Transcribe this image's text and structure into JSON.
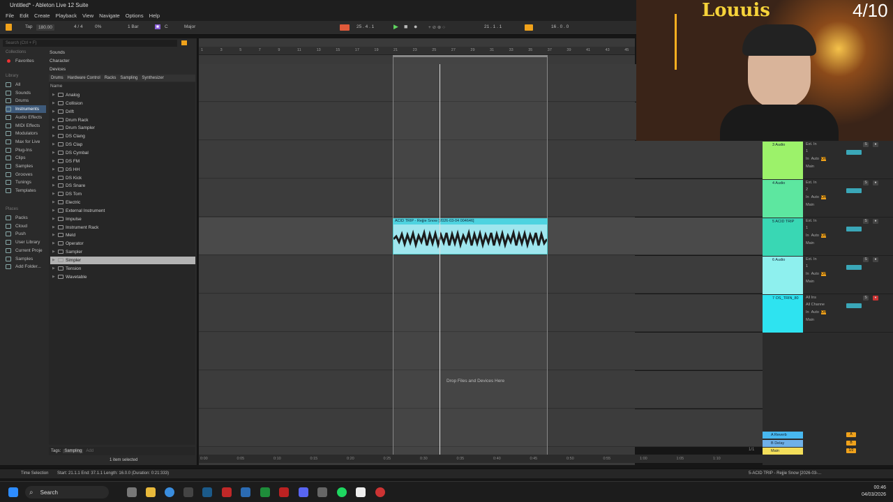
{
  "window": {
    "title": "Untitled* - Ableton Live 12 Suite"
  },
  "menu": [
    "File",
    "Edit",
    "Create",
    "Playback",
    "View",
    "Navigate",
    "Options",
    "Help"
  ],
  "transport": {
    "tap": "Tap",
    "tempo": "180.00",
    "signature": "4 / 4",
    "percent": "0%",
    "quant": "1 Bar",
    "key": "C",
    "scale": "Major",
    "position": "25 . 4 . 1",
    "loop_start": "21 . 1 . 1",
    "loop_length": "16 . 0 . 0"
  },
  "browser": {
    "search_placeholder": "Search (Ctrl + F)",
    "collections_head": "Collections",
    "favorites": "Favorites",
    "library_head": "Library",
    "library_items": [
      "All",
      "Sounds",
      "Drums",
      "Instruments",
      "Audio Effects",
      "MIDI Effects",
      "Modulators",
      "Max for Live",
      "Plug-Ins",
      "Clips",
      "Samples",
      "Grooves",
      "Tunings",
      "Templates"
    ],
    "places_head": "Places",
    "places_items": [
      "Packs",
      "Cloud",
      "Push",
      "User Library",
      "Current Proje",
      "Samples",
      "Add Folder..."
    ],
    "filters": {
      "sounds": "Sounds",
      "character": "Character",
      "devices": "Devices"
    },
    "tags": [
      "Drums",
      "Hardware Control",
      "Racks",
      "Sampling",
      "Synthesizer"
    ],
    "name_header": "Name",
    "devices": [
      "Analog",
      "Collision",
      "Drift",
      "Drum Rack",
      "Drum Sampler",
      "DS Clang",
      "DS Clap",
      "DS Cymbal",
      "DS FM",
      "DS HH",
      "DS Kick",
      "DS Snare",
      "DS Tom",
      "Electric",
      "External Instrument",
      "Impulse",
      "Instrument Rack",
      "Meld",
      "Operator",
      "Sampler",
      "Simpler",
      "Tension",
      "Wavetable"
    ],
    "selected_device": "Simpler",
    "tags_label": "Tags:",
    "tags_value": "Sampling",
    "tags_add": "Add",
    "selection_count": "1 item selected"
  },
  "ruler": [
    "1",
    "3",
    "5",
    "7",
    "9",
    "11",
    "13",
    "15",
    "17",
    "19",
    "21",
    "23",
    "25",
    "27",
    "29",
    "31",
    "33",
    "35",
    "37",
    "39",
    "41",
    "43",
    "45"
  ],
  "clip": {
    "title": "ACID TRIP - Rejjie Snow [2026-03-04 004646]"
  },
  "dropzone": "Drop Files and Devices Here",
  "timeline": [
    "0:00",
    "0:05",
    "0:10",
    "0:15",
    "0:20",
    "0:25",
    "0:30",
    "0:35",
    "0:40",
    "0:45",
    "0:50",
    "0:55",
    "1:00",
    "1:05",
    "1:10"
  ],
  "tracks": [
    {
      "name": "3 Audio",
      "input": "Ext. In",
      "channel": "1",
      "color": "#9cf26a"
    },
    {
      "name": "4 Audio",
      "input": "Ext. In",
      "channel": "2",
      "color": "#5de7a0"
    },
    {
      "name": "5 ACID TRIP",
      "input": "Ext. In",
      "channel": "1",
      "color": "#39d7b4"
    },
    {
      "name": "6 Audio",
      "input": "Ext. In",
      "channel": "1",
      "color": "#8ef0ee"
    },
    {
      "name": "7 OS_TRIN_80",
      "input": "All Ins",
      "channel": "All Channe",
      "color": "#2ee3f0"
    }
  ],
  "mixer_labels": {
    "in": "In",
    "auto": "Auto",
    "off": "Off",
    "main": "Main"
  },
  "returns": [
    {
      "name": "A Reverb",
      "letter": "A",
      "color": "#48b8f0"
    },
    {
      "name": "B Delay",
      "letter": "B",
      "color": "#6fb0e8"
    },
    {
      "name": "Main",
      "letter": "1/2",
      "color": "#f3de5a"
    }
  ],
  "scene_count": "1/1",
  "webcam": {
    "overlay_name": "Louuis",
    "counter": "4/10"
  },
  "status": {
    "mode": "Time Selection",
    "range": "Start: 21.1.1   End: 37.1.1   Length: 16.0.0 (Duration: 0:21:333)",
    "clip_name": "5-ACID TRIP - Rejjie Snow [2026-03-..."
  },
  "taskbar": {
    "search": "Search",
    "time": "00:46",
    "date": "04/03/2026"
  }
}
